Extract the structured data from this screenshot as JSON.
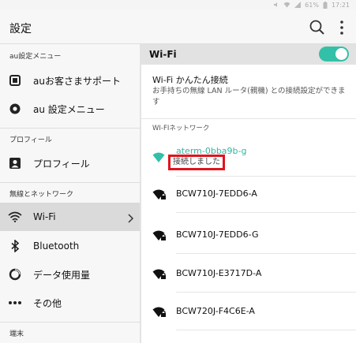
{
  "status_bar": {
    "battery_text": "61%",
    "time": "17:21"
  },
  "app_bar": {
    "title": "設定"
  },
  "sidebar": {
    "sections": [
      {
        "header": "au設定メニュー",
        "items": [
          {
            "label": "auお客さまサポート",
            "icon": "au-support-icon"
          },
          {
            "label": "au 設定メニュー",
            "icon": "au-gear-icon"
          }
        ]
      },
      {
        "header": "プロフィール",
        "items": [
          {
            "label": "プロフィール",
            "icon": "profile-card-icon"
          }
        ]
      },
      {
        "header": "無線とネットワーク",
        "items": [
          {
            "label": "Wi-Fi",
            "icon": "wifi-icon",
            "selected": true
          },
          {
            "label": "Bluetooth",
            "icon": "bluetooth-icon"
          },
          {
            "label": "データ使用量",
            "icon": "data-usage-icon"
          },
          {
            "label": "その他",
            "icon": "more-dots-icon"
          }
        ]
      },
      {
        "header": "端末",
        "items": []
      }
    ]
  },
  "wifi_panel": {
    "toggle_label": "Wi-Fi",
    "toggle_on": true,
    "easy_connect": {
      "title": "Wi-Fi かんたん接続",
      "description": "お手持ちの無線 LAN ルータ(親機) との接続設定ができます"
    },
    "networks_header": "WI-FIネットワーク",
    "networks": [
      {
        "ssid": "aterm-0bba9b-g",
        "status": "接続しました",
        "connected": true
      },
      {
        "ssid": "BCW710J-7EDD6-A",
        "connected": false
      },
      {
        "ssid": "BCW710J-7EDD6-G",
        "connected": false
      },
      {
        "ssid": "BCW710J-E3717D-A",
        "connected": false
      },
      {
        "ssid": "BCW720J-F4C6E-A",
        "connected": false
      }
    ]
  },
  "colors": {
    "accent": "#33c0a8",
    "connected_text": "#2fb7a2",
    "highlight_box": "#e0141e"
  }
}
